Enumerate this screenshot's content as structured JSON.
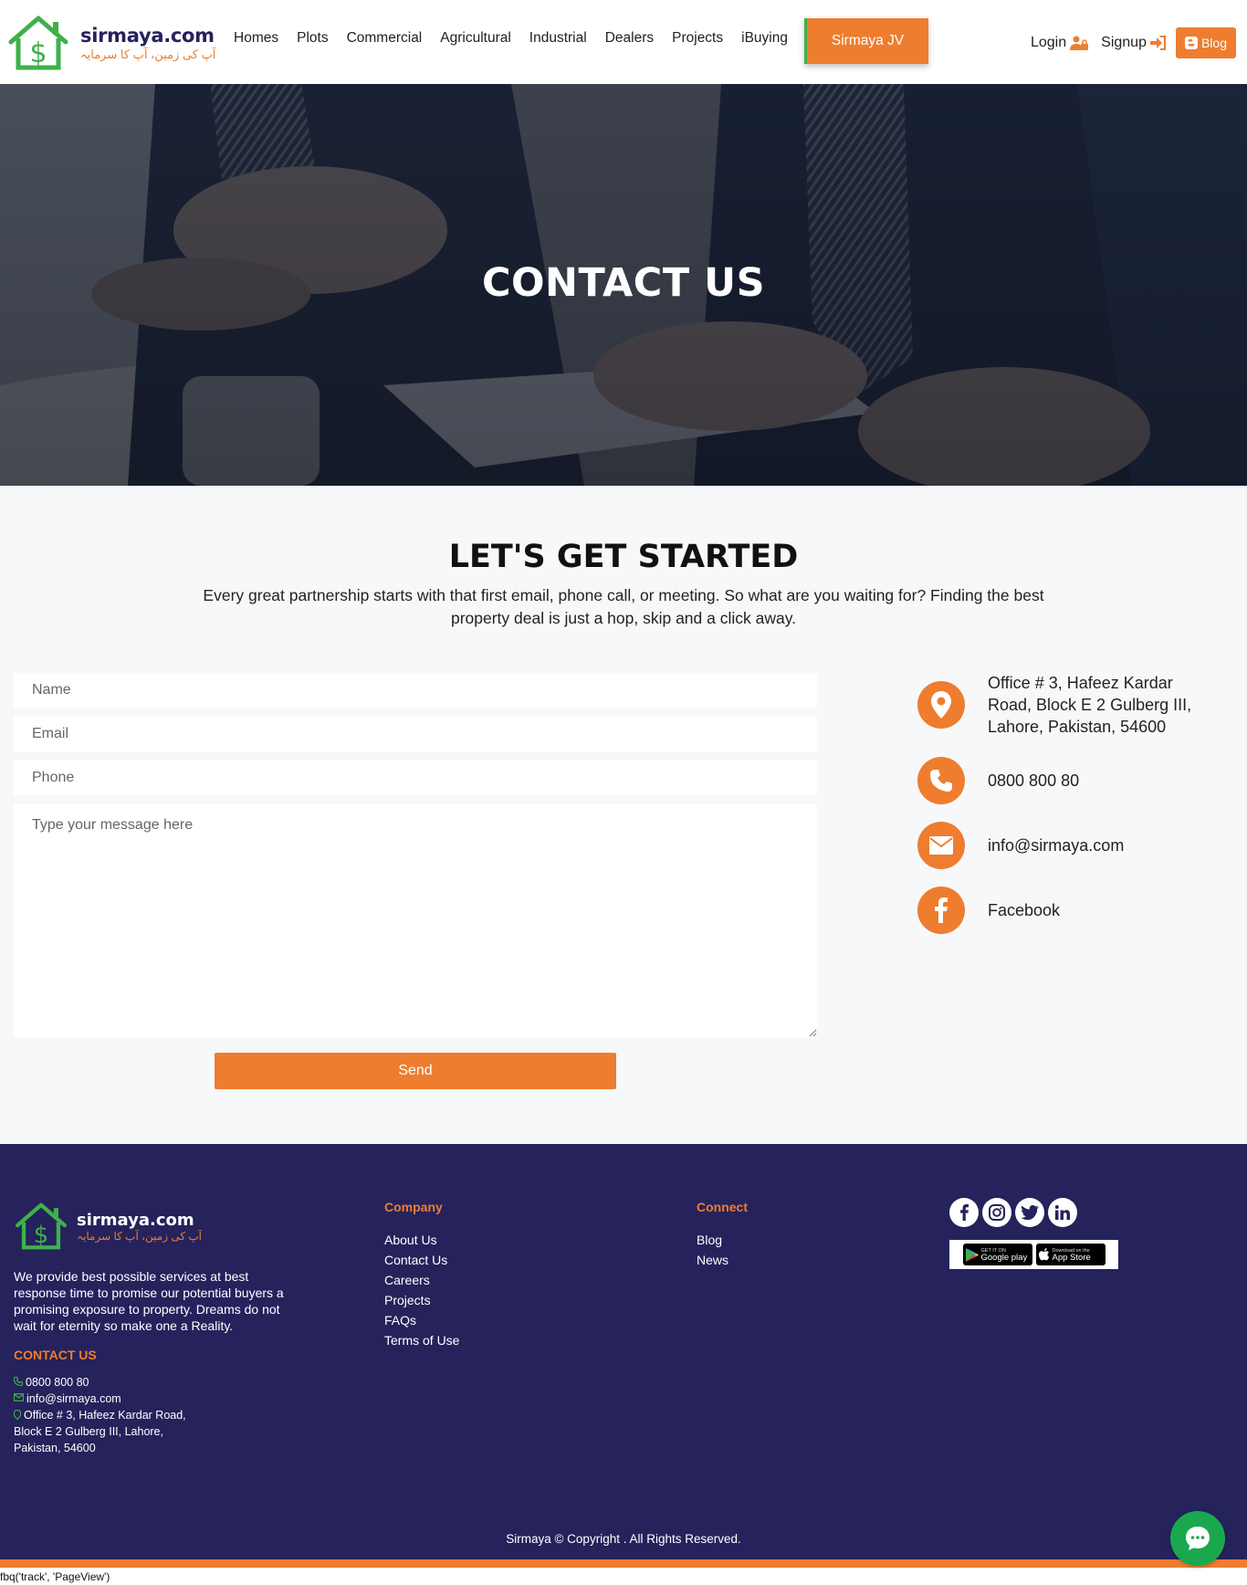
{
  "header": {
    "logo_name": "sirmaya.com",
    "logo_tagline": "آپ کی زمین، آپ کا سرمایہ",
    "nav": [
      "Homes",
      "Plots",
      "Commercial",
      "Agricultural",
      "Industrial",
      "Dealers",
      "Projects",
      "iBuying"
    ],
    "jv_label": "Sirmaya JV",
    "login_label": "Login",
    "signup_label": "Signup",
    "blog_label": "Blog"
  },
  "hero": {
    "title": "CONTACT US"
  },
  "contact_section": {
    "title": "LET'S GET STARTED",
    "subtitle": "Every great partnership starts with that first email, phone call, or meeting. So what are you waiting for? Finding the best property deal is just a hop, skip and a click away.",
    "form": {
      "name_placeholder": "Name",
      "email_placeholder": "Email",
      "phone_placeholder": "Phone",
      "message_placeholder": "Type your message here",
      "send_label": "Send"
    },
    "info": {
      "address": "Office # 3, Hafeez Kardar Road, Block E 2 Gulberg III, Lahore, Pakistan, 54600",
      "phone": "0800 800 80",
      "email": "info@sirmaya.com",
      "facebook": "Facebook"
    }
  },
  "footer": {
    "logo_name": "sirmaya.com",
    "logo_tagline": "آپ کی زمین، آپ کا سرمایہ",
    "description": "We provide best possible services at best response time to promise our potential buyers a promising exposure to property. Dreams do not wait for eternity so make one a Reality.",
    "contact_title": "CONTACT US",
    "contact_phone": "0800 800 80",
    "contact_email": "info@sirmaya.com",
    "contact_address_1": "Office # 3, Hafeez Kardar Road,",
    "contact_address_2": "Block E 2 Gulberg III, Lahore,",
    "contact_address_3": "Pakistan, 54600",
    "company_title": "Company",
    "company_links": [
      "About Us",
      "Contact Us",
      "Careers",
      "Projects",
      "FAQs",
      "Terms of Use"
    ],
    "connect_title": "Connect",
    "connect_links": [
      "Blog",
      "News"
    ],
    "google_play_small": "GET IT ON",
    "google_play_label": "Google play",
    "app_store_small": "Download on the",
    "app_store_label": "App Store",
    "copyright": "Sirmaya © Copyright . All Rights Reserved."
  },
  "debug_text": "fbq('track', 'PageView')",
  "colors": {
    "accent": "#ee7d30",
    "navy": "#25225c",
    "green": "#3db14a",
    "chat": "#1aa84e"
  }
}
